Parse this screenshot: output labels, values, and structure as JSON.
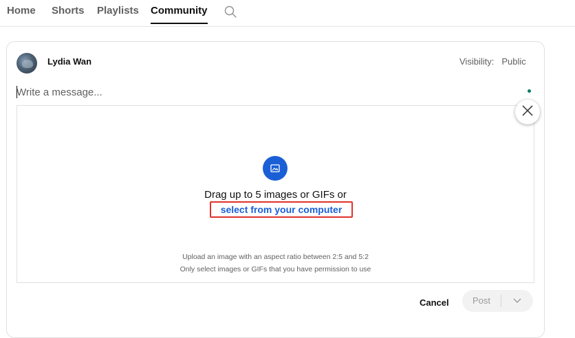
{
  "tabs": [
    {
      "label": "Home",
      "active": false
    },
    {
      "label": "Shorts",
      "active": false
    },
    {
      "label": "Playlists",
      "active": false
    },
    {
      "label": "Community",
      "active": true
    }
  ],
  "search_icon": "search-icon",
  "post": {
    "username": "Lydia Wan",
    "visibility_label": "Visibility:",
    "visibility_value": "Public",
    "message_placeholder": "Write a message...",
    "message_value": ""
  },
  "upload": {
    "drag_text": "Drag up to 5 images or GIFs or",
    "select_link": "select from your computer",
    "hint_line1": "Upload an image with an aspect ratio between 2:5 and 5:2",
    "hint_line2": "Only select images or GIFs that you have permission to use",
    "icon": "image-icon"
  },
  "actions": {
    "cancel_label": "Cancel",
    "post_label": "Post",
    "dropdown_icon": "chevron-down-icon",
    "close_icon": "close-icon"
  },
  "colors": {
    "accent_blue": "#1a5fd6",
    "highlight_red": "#e0312a",
    "status_green": "#0a7c68"
  }
}
